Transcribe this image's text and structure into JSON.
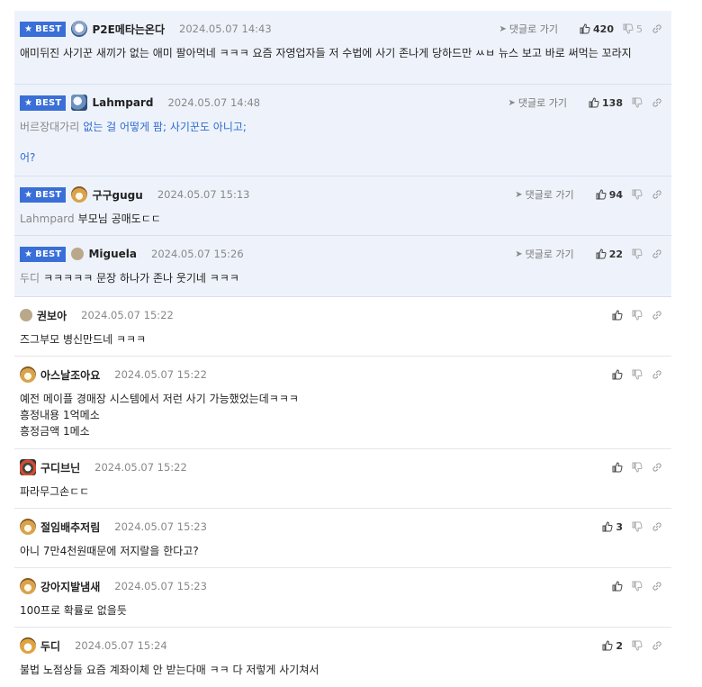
{
  "reply_label": "댓글로 가기",
  "best_label": "BEST",
  "comments": [
    {
      "best": true,
      "nick": "P2E메타는온다",
      "date": "2024.05.07 14:43",
      "likes": "420",
      "dislikes": "5",
      "lines": [
        "애미뒤진 사기꾼 새끼가 없는 애미 팔아먹네 ㅋㅋㅋ 요즘 자영업자들 저 수법에 사기 존나게 당하드만 ㅆㅂ 뉴스 보고 바로 써먹는 꼬라지"
      ]
    },
    {
      "best": true,
      "nick": "Lahmpard",
      "date": "2024.05.07 14:48",
      "likes": "138",
      "mention": "버르장대가리",
      "quote": "없는 걸 어떻게 팜; 사기꾼도 아니고;",
      "extra": "어?"
    },
    {
      "best": true,
      "nick": "구구gugu",
      "date": "2024.05.07 15:13",
      "likes": "94",
      "mention": "Lahmpard",
      "text": "부모님 공매도ㄷㄷ"
    },
    {
      "best": true,
      "nick": "Miguela",
      "date": "2024.05.07 15:26",
      "likes": "22",
      "mention": "두디",
      "text": "ㅋㅋㅋㅋㅋ 문장 하나가 존나 웃기네 ㅋㅋㅋ"
    },
    {
      "nick": "권보아",
      "date": "2024.05.07 15:22",
      "lines": [
        "즈그부모 병신만드네 ㅋㅋㅋ"
      ]
    },
    {
      "nick": "아스날조아요",
      "date": "2024.05.07 15:22",
      "lines": [
        "예전 메이플 경매장 시스템에서 저런 사기 가능했었는데ㅋㅋㅋ",
        "흥정내용 1억메소",
        "흥정금액 1메소"
      ]
    },
    {
      "nick": "구디브닌",
      "date": "2024.05.07 15:22",
      "lines": [
        "파라무그손ㄷㄷ"
      ]
    },
    {
      "nick": "절임배추저림",
      "date": "2024.05.07 15:23",
      "likes": "3",
      "lines": [
        "아니 7만4천원때문에 저지랄을 한다고?"
      ]
    },
    {
      "nick": "강아지발냄새",
      "date": "2024.05.07 15:23",
      "lines": [
        "100프로 확률로 없을듯"
      ]
    },
    {
      "nick": "두디",
      "date": "2024.05.07 15:24",
      "likes": "2",
      "lines": [
        "불법 노점상들 요즘 계좌이체 안 받는다매 ㅋㅋ 다 저렇게 사기쳐서"
      ]
    }
  ]
}
